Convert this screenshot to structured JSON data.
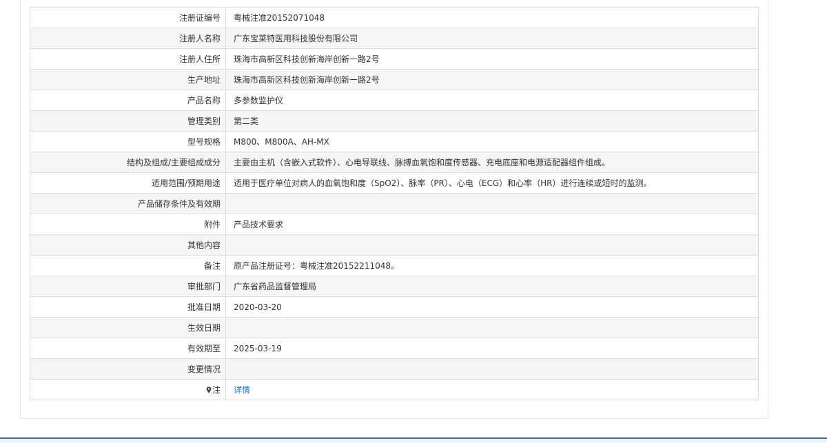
{
  "record": {
    "rows": [
      {
        "label": "注册证编号",
        "value": "粤械注准20152071048"
      },
      {
        "label": "注册人名称",
        "value": "广东宝莱特医用科技股份有限公司"
      },
      {
        "label": "注册人住所",
        "value": "珠海市高新区科技创新海岸创新一路2号"
      },
      {
        "label": "生产地址",
        "value": "珠海市高新区科技创新海岸创新一路2号"
      },
      {
        "label": "产品名称",
        "value": "多参数监护仪"
      },
      {
        "label": "管理类别",
        "value": "第二类"
      },
      {
        "label": "型号规格",
        "value": "M800、M800A、AH-MX"
      },
      {
        "label": "结构及组成/主要组成成分",
        "value": "主要由主机（含嵌入式软件）、心电导联线、脉搏血氧饱和度传感器、充电底座和电源适配器组件组成。"
      },
      {
        "label": "适用范围/预期用途",
        "value": "适用于医疗单位对病人的血氧饱和度（SpO2）、脉率（PR）、心电（ECG）和心率（HR）进行连续或短时的监测。"
      },
      {
        "label": "产品储存条件及有效期",
        "value": ""
      },
      {
        "label": "附件",
        "value": "产品技术要求"
      },
      {
        "label": "其他内容",
        "value": ""
      },
      {
        "label": "备注",
        "value": "原产品注册证号：粤械注准20152211048。"
      },
      {
        "label": "审批部门",
        "value": "广东省药品监督管理局"
      },
      {
        "label": "批准日期",
        "value": "2020-03-20"
      },
      {
        "label": "生效日期",
        "value": ""
      },
      {
        "label": "有效期至",
        "value": "2025-03-19"
      },
      {
        "label": "变更情况",
        "value": ""
      }
    ],
    "note": {
      "icon": "pin-icon",
      "label": "注",
      "link": "详情"
    }
  },
  "colors": {
    "link": "#1a73c8",
    "border": "#dcdcdc",
    "stripe": "#f5f5f5",
    "bottom_rule": "#2f6db5"
  }
}
